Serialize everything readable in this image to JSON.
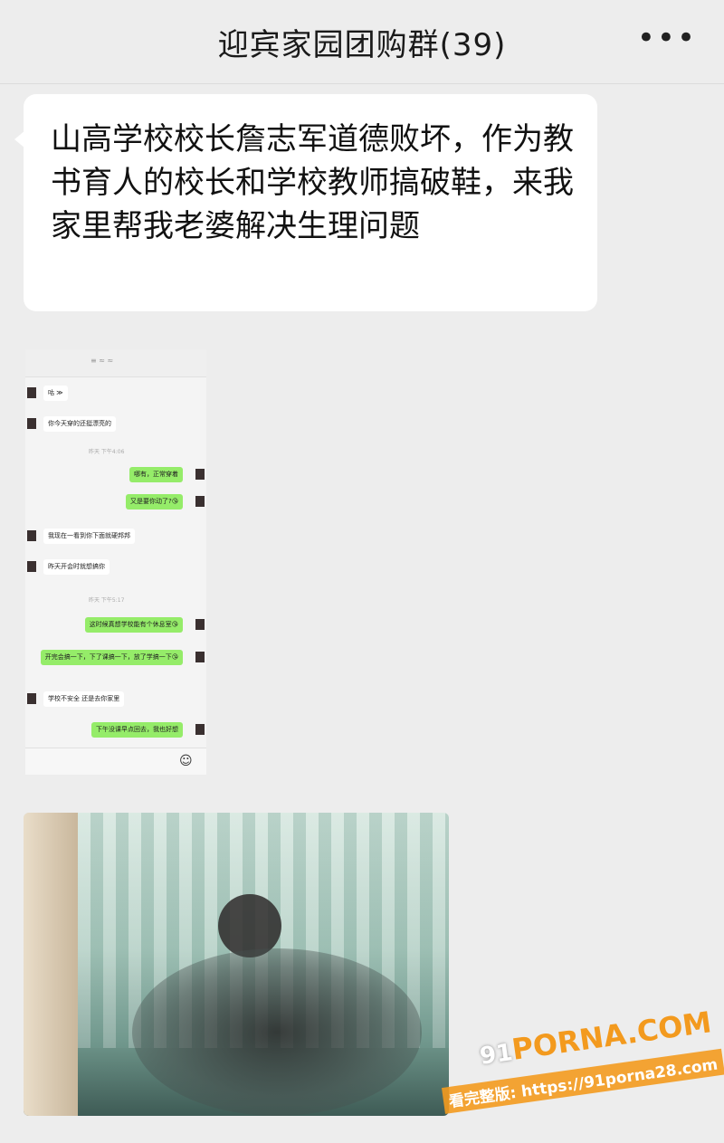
{
  "header": {
    "title": "迎宾家园团购群(39)",
    "more_icon": "more-icon",
    "more_glyph": "•••"
  },
  "message": {
    "text": "山高学校校长詹志军道德败坏，作为教书育人的校长和学校教师搞破鞋，来我家里帮我老婆解决生理问题"
  },
  "embedded_chat": {
    "header_text": "≡ ≈ ≈",
    "messages": [
      {
        "side": "in",
        "text": "咕 ≫"
      },
      {
        "side": "in",
        "text": "你今天穿的还挺漂亮的"
      },
      {
        "side": "time",
        "text": "昨天 下午4:06"
      },
      {
        "side": "out",
        "text": "哪有，正常穿着"
      },
      {
        "side": "out",
        "text": "又是要你动了?😘"
      },
      {
        "side": "in",
        "text": "我现在一看到你下面就硬邦邦"
      },
      {
        "side": "in",
        "text": "昨天开会时就想搞你"
      },
      {
        "side": "time",
        "text": "昨天 下午5:17"
      },
      {
        "side": "out",
        "text": "这时候真想学校能有个休息室😘"
      },
      {
        "side": "out",
        "text": "开完会搞一下，下了课搞一下，放了学搞一下😘"
      },
      {
        "side": "in",
        "text": "学校不安全 还是去你家里"
      },
      {
        "side": "out",
        "text": "下午没课早点回去，我也好想"
      }
    ],
    "input_emoji": "☺"
  },
  "watermark": {
    "logo_prefix": "91",
    "logo_text": "PORNA.COM",
    "url_text": "看完整版: https://91porna28.com"
  }
}
